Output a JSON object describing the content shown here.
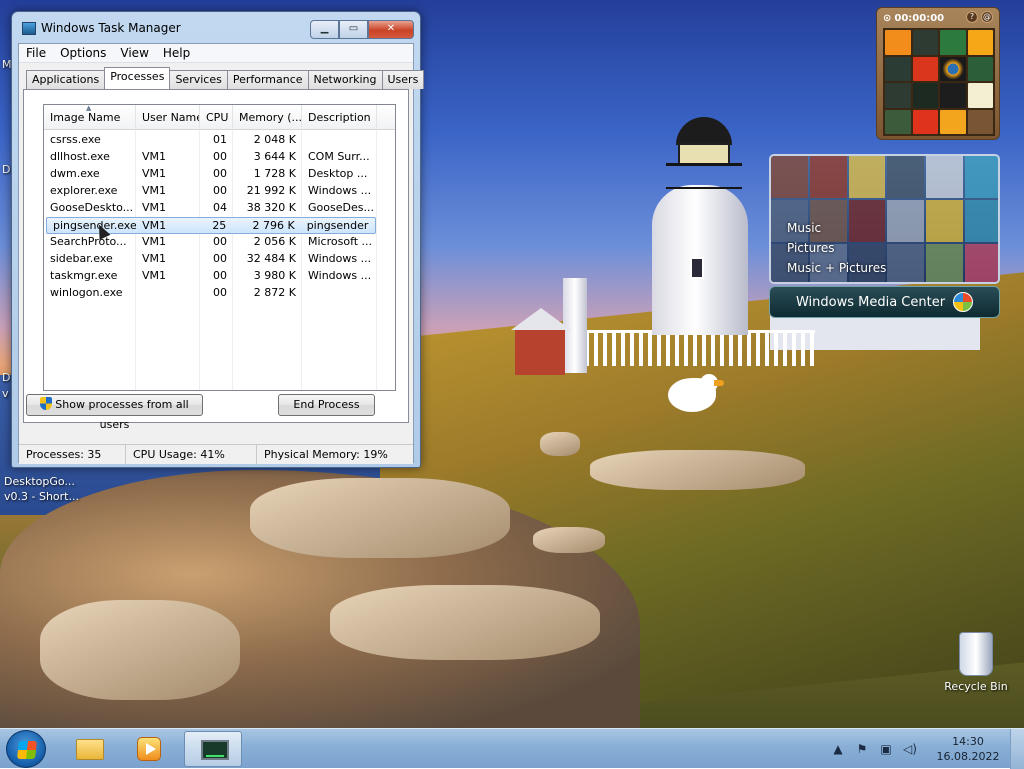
{
  "desktop": {
    "left_labels": [
      "M",
      "D",
      "D",
      "v"
    ],
    "shortcut_label_line1": "DesktopGo...",
    "shortcut_label_line2": "v0.3 - Short...",
    "recycle_bin_label": "Recycle Bin"
  },
  "puzzle_gadget": {
    "timer": "00:00:00",
    "help_label": "?",
    "close_label": "@"
  },
  "media_center_gadget": {
    "menu_items": [
      "Music",
      "Pictures",
      "Music + Pictures"
    ],
    "brand_label": "Windows Media Center"
  },
  "task_manager": {
    "title": "Windows Task Manager",
    "menu": [
      "File",
      "Options",
      "View",
      "Help"
    ],
    "tabs": [
      "Applications",
      "Processes",
      "Services",
      "Performance",
      "Networking",
      "Users"
    ],
    "active_tab": "Processes",
    "columns": [
      "Image Name",
      "User Name",
      "CPU",
      "Memory (...",
      "Description"
    ],
    "processes": [
      {
        "image": "csrss.exe",
        "user": "",
        "cpu": "01",
        "memory": "2 048 K",
        "description": ""
      },
      {
        "image": "dllhost.exe",
        "user": "VM1",
        "cpu": "00",
        "memory": "3 644 K",
        "description": "COM Surr..."
      },
      {
        "image": "dwm.exe",
        "user": "VM1",
        "cpu": "00",
        "memory": "1 728 K",
        "description": "Desktop ..."
      },
      {
        "image": "explorer.exe",
        "user": "VM1",
        "cpu": "00",
        "memory": "21 992 K",
        "description": "Windows ..."
      },
      {
        "image": "GooseDeskto...",
        "user": "VM1",
        "cpu": "04",
        "memory": "38 320 K",
        "description": "GooseDes..."
      },
      {
        "image": "pingsender.exe",
        "user": "VM1",
        "cpu": "25",
        "memory": "2 796 K",
        "description": "pingsender"
      },
      {
        "image": "SearchProto...",
        "user": "VM1",
        "cpu": "00",
        "memory": "2 056 K",
        "description": "Microsoft ..."
      },
      {
        "image": "sidebar.exe",
        "user": "VM1",
        "cpu": "00",
        "memory": "32 484 K",
        "description": "Windows ..."
      },
      {
        "image": "taskmgr.exe",
        "user": "VM1",
        "cpu": "00",
        "memory": "3 980 K",
        "description": "Windows ..."
      },
      {
        "image": "winlogon.exe",
        "user": "",
        "cpu": "00",
        "memory": "2 872 K",
        "description": ""
      }
    ],
    "selected_process": "pingsender.exe",
    "show_all_button": "Show processes from all users",
    "end_process_button": "End Process",
    "status": {
      "processes": "Processes: 35",
      "cpu": "CPU Usage: 41%",
      "memory": "Physical Memory: 19%"
    }
  },
  "taskbar": {
    "clock_time": "14:30",
    "clock_date": "16.08.2022"
  },
  "colors": {
    "taskbar": "#89afd6",
    "selection": "#cde5fb",
    "close_button": "#c94326"
  }
}
